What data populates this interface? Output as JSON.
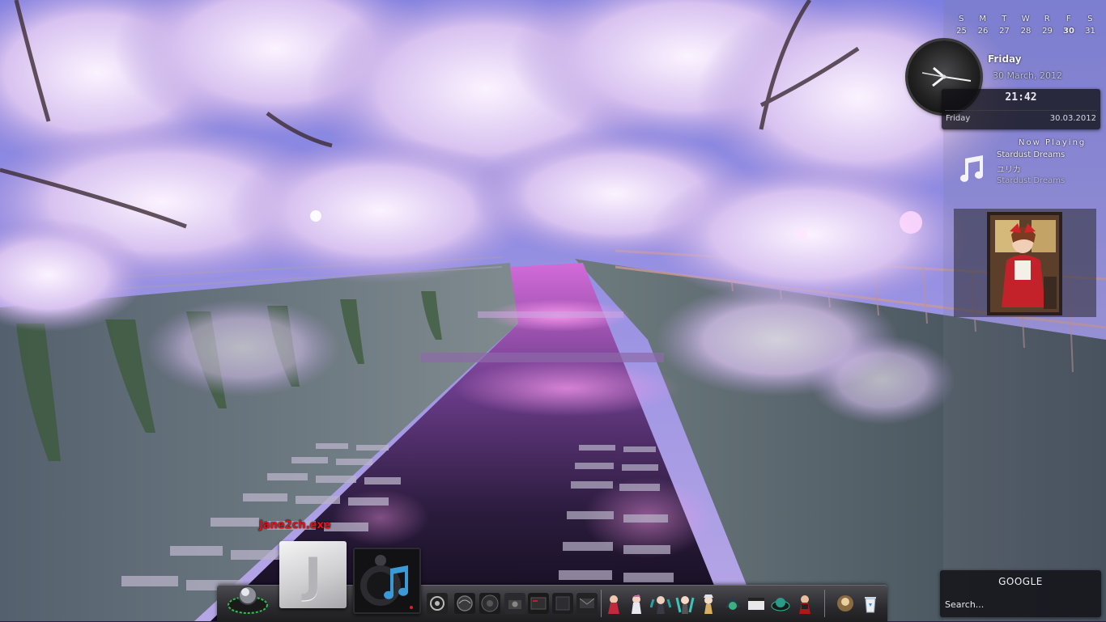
{
  "calendar": {
    "weekdays": [
      "S",
      "M",
      "T",
      "W",
      "R",
      "F",
      "S"
    ],
    "dates": [
      "25",
      "26",
      "27",
      "28",
      "29",
      "30",
      "31"
    ],
    "today": "30"
  },
  "clock_gadget": {
    "day": "Friday",
    "date_long": "30 March, 2012"
  },
  "digital_clock": {
    "time": "21:42",
    "day": "Friday",
    "date": "30.03.2012"
  },
  "now_playing": {
    "title": "Now Playing",
    "track": "Stardust Dreams",
    "artist": "ユリカ",
    "album": "Stardust Dreams",
    "icon": "music-note-icon"
  },
  "search_gadget": {
    "title": "GOOGLE",
    "placeholder": "Search..."
  },
  "dock": {
    "hover_label": "Jane2ch.exe",
    "big_j_letter": "J"
  },
  "colors": {
    "dock_label": "#e0151b",
    "panel_bg": "#141419"
  }
}
